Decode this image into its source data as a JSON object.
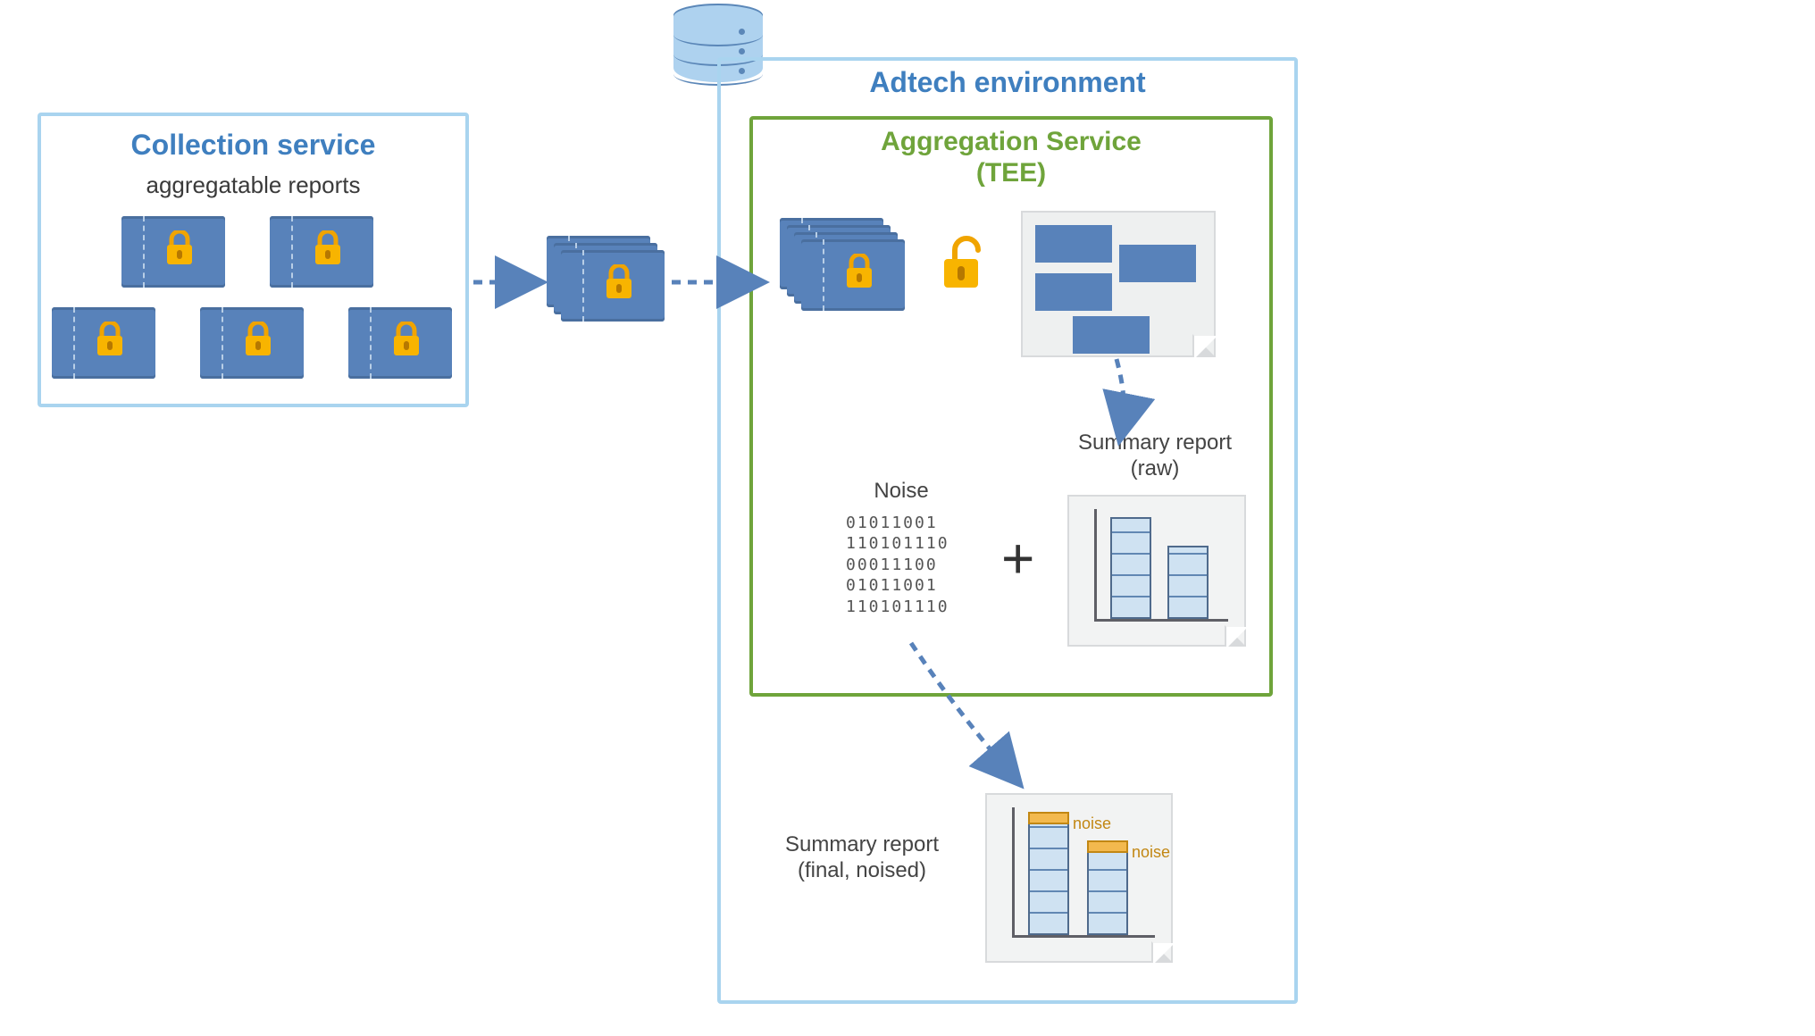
{
  "collection": {
    "title": "Collection service",
    "subtitle": "aggregatable reports"
  },
  "adtech": {
    "title": "Adtech environment"
  },
  "tee": {
    "title_line1": "Aggregation Service",
    "title_line2": "(TEE)"
  },
  "noise": {
    "label": "Noise",
    "rows": [
      "01011001",
      "110101110",
      "00011100",
      "01011001",
      "110101110"
    ]
  },
  "summary_raw": {
    "label_line1": "Summary report",
    "label_line2": "(raw)"
  },
  "summary_final": {
    "label_line1": "Summary report",
    "label_line2": "(final, noised)",
    "noise_tag": "noise"
  },
  "plus": "+",
  "icons": {
    "database": "database-icon",
    "lock": "lock-icon",
    "unlock": "unlock-icon",
    "report": "locked-report-icon"
  }
}
